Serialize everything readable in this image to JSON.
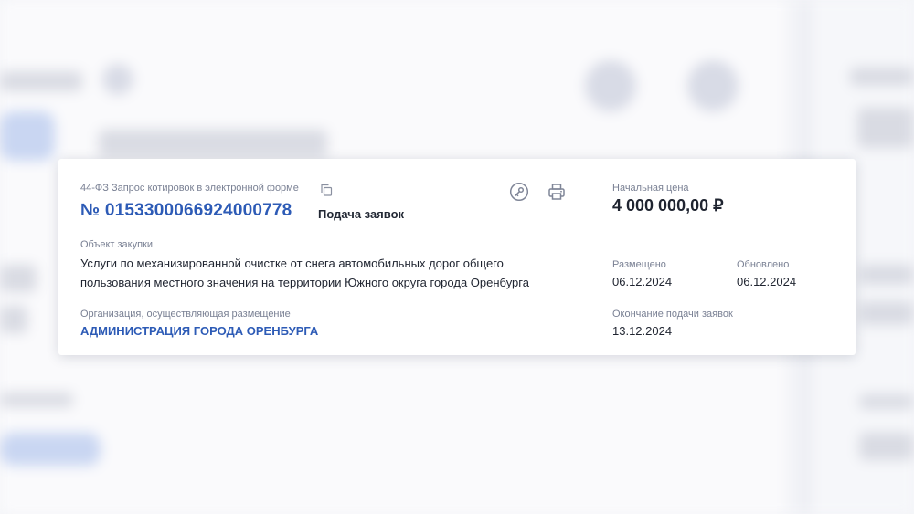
{
  "card": {
    "law_type": "44-ФЗ Запрос котировок в электронной форме",
    "number": "№ 0153300066924000778",
    "stage": "Подача заявок",
    "object_label": "Объект закупки",
    "object_text": "Услуги по механизированной очистке от снега автомобильных дорог общего пользования местного значения на территории Южного округа города Оренбурга",
    "org_label": "Организация, осуществляющая размещение",
    "org_name": "АДМИНИСТРАЦИЯ ГОРОДА ОРЕНБУРГА",
    "price_label": "Начальная цена",
    "price": "4 000 000,00 ₽",
    "placed_label": "Размещено",
    "placed_date": "06.12.2024",
    "updated_label": "Обновлено",
    "updated_date": "06.12.2024",
    "end_label": "Окончание подачи заявок",
    "end_date": "13.12.2024"
  },
  "icons": {
    "copy": "copy-icon",
    "key": "key-icon",
    "print": "print-icon"
  },
  "colors": {
    "accent": "#2d5bb6",
    "text": "#1f2430",
    "muted": "#7a8194"
  }
}
